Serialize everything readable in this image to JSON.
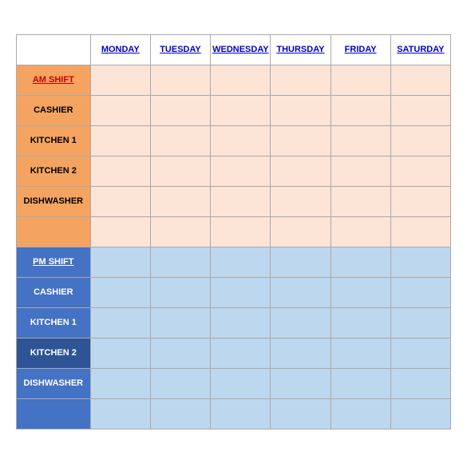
{
  "header": {
    "label_col": "",
    "days": [
      "MONDAY",
      "TUESDAY",
      "WEDNESDAY",
      "THURSDAY",
      "FRIDAY",
      "SATURDAY"
    ]
  },
  "rows": [
    {
      "label": "AM SHIFT",
      "type": "shift-header-orange",
      "cells": "orange"
    },
    {
      "label": "CASHIER",
      "type": "label-orange",
      "cells": "orange"
    },
    {
      "label": "KITCHEN 1",
      "type": "label-orange",
      "cells": "orange"
    },
    {
      "label": "KITCHEN 2",
      "type": "label-orange",
      "cells": "orange"
    },
    {
      "label": "DISHWASHER",
      "type": "label-orange",
      "cells": "orange"
    },
    {
      "label": "",
      "type": "empty-orange",
      "cells": "orange"
    },
    {
      "label": "PM SHIFT",
      "type": "shift-header-blue",
      "cells": "blue"
    },
    {
      "label": "CASHIER",
      "type": "label-blue",
      "cells": "blue"
    },
    {
      "label": "KITCHEN 1",
      "type": "label-blue",
      "cells": "blue"
    },
    {
      "label": "KITCHEN 2",
      "type": "label-blue-dark",
      "cells": "blue"
    },
    {
      "label": "DISHWASHER",
      "type": "label-blue",
      "cells": "blue"
    },
    {
      "label": "",
      "type": "empty-blue",
      "cells": "blue"
    }
  ]
}
